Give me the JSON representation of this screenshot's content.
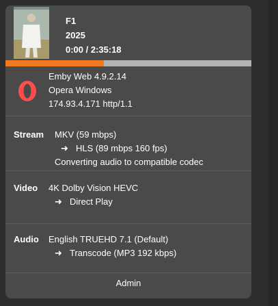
{
  "media": {
    "title": "F1",
    "year": "2025",
    "position": "0:00 / 2:35:18",
    "progress_fraction": 0.4
  },
  "client": {
    "app": "Emby Web 4.9.2.14",
    "device": "Opera Windows",
    "address": "174.93.4.171 http/1.1",
    "logo_icon": "opera-logo-icon"
  },
  "stream": {
    "label": "Stream",
    "line1": "MKV (59 mbps)",
    "line2": "HLS (89 mbps 160 fps)",
    "line3": "Converting audio to compatible codec"
  },
  "video": {
    "label": "Video",
    "line1": "4K Dolby Vision HEVC",
    "line2": "Direct Play"
  },
  "audio": {
    "label": "Audio",
    "line1": "English TRUEHD 7.1 (Default)",
    "line2": "Transcode (MP3 192 kbps)"
  },
  "footer": {
    "user": "Admin"
  },
  "arrow_glyph": "➜",
  "colors": {
    "card_bg": "#4a4a4a",
    "page_bg": "#2d2d2d",
    "progress_fill": "#f07b23",
    "progress_track": "#b3b3b3",
    "opera_red": "#ff4c4c"
  }
}
